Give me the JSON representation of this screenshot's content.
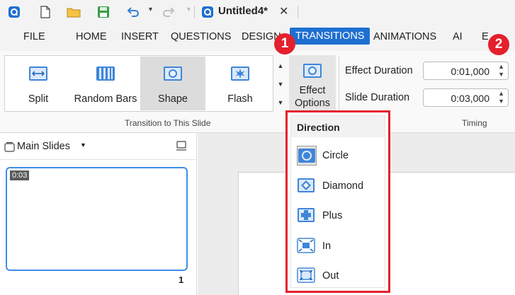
{
  "titlebar": {
    "document_title": "Untitled4*"
  },
  "menu": {
    "items": [
      "FILE",
      "HOME",
      "INSERT",
      "QUESTIONS",
      "DESIGN",
      "TRANSITIONS",
      "ANIMATIONS",
      "AI",
      "E"
    ],
    "active": "TRANSITIONS"
  },
  "ribbon": {
    "transitions": [
      {
        "label": "Split",
        "icon": "split-icon"
      },
      {
        "label": "Random Bars",
        "icon": "random-bars-icon"
      },
      {
        "label": "Shape",
        "icon": "shape-icon",
        "selected": true
      },
      {
        "label": "Flash",
        "icon": "flash-icon"
      }
    ],
    "effect_options_line1": "Effect",
    "effect_options_line2": "Options",
    "group_transition_label": "Transition to This Slide",
    "effect_duration_label": "Effect Duration",
    "effect_duration_value": "0:01,000",
    "slide_duration_label": "Slide Duration",
    "slide_duration_value": "0:03,000",
    "group_timing_label": "Timing"
  },
  "slides_panel": {
    "title": "Main Slides",
    "thumb_badge": "0:03",
    "slide_number": "1"
  },
  "dropdown": {
    "header": "Direction",
    "items": [
      {
        "label": "Circle",
        "icon": "circle-icon",
        "selected": true
      },
      {
        "label": "Diamond",
        "icon": "diamond-icon"
      },
      {
        "label": "Plus",
        "icon": "plus-icon"
      },
      {
        "label": "In",
        "icon": "in-icon"
      },
      {
        "label": "Out",
        "icon": "out-icon"
      }
    ]
  },
  "callouts": [
    "1",
    "2"
  ],
  "colors": {
    "accent": "#1f6fd1",
    "callout": "#e4202c",
    "selection": "#3d8ee8"
  }
}
